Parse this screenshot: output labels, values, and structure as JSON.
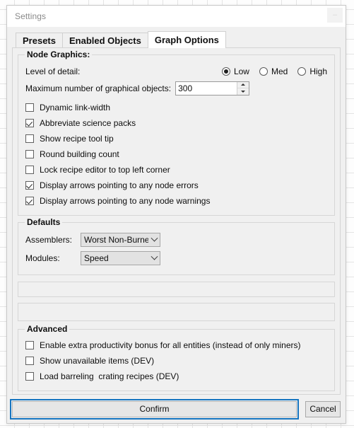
{
  "window": {
    "title": "Settings",
    "minimize_label": "–"
  },
  "tabs": [
    {
      "label": "Presets",
      "selected": false
    },
    {
      "label": "Enabled Objects",
      "selected": false
    },
    {
      "label": "Graph Options",
      "selected": true
    }
  ],
  "node_graphics": {
    "title": "Node Graphics:",
    "level_of_detail_label": "Level of detail:",
    "level_of_detail_options": [
      {
        "label": "Low",
        "selected": true
      },
      {
        "label": "Med",
        "selected": false
      },
      {
        "label": "High",
        "selected": false
      }
    ],
    "max_objects_label": "Maximum number of graphical objects:",
    "max_objects_value": "300",
    "checkboxes": [
      {
        "label": "Dynamic link-width",
        "checked": false
      },
      {
        "label": "Abbreviate science packs",
        "checked": true
      },
      {
        "label": "Show recipe tool tip",
        "checked": false
      },
      {
        "label": "Round building count",
        "checked": false
      },
      {
        "label": "Lock recipe editor to top left corner",
        "checked": false
      },
      {
        "label": "Display arrows pointing to any node errors",
        "checked": true
      },
      {
        "label": "Display arrows pointing to any node warnings",
        "checked": true
      }
    ]
  },
  "defaults": {
    "title": "Defaults",
    "assemblers_label": "Assemblers:",
    "assemblers_value": "Worst Non-Burner",
    "modules_label": "Modules:",
    "modules_value": "Speed"
  },
  "advanced": {
    "title": "Advanced",
    "checkboxes": [
      {
        "label": "Enable extra productivity bonus for all entities (instead of only miners)",
        "checked": false
      },
      {
        "label": "Show unavailable items (DEV)",
        "checked": false
      },
      {
        "label": "Load barreling  crating recipes (DEV)",
        "checked": false
      }
    ]
  },
  "footer": {
    "confirm_label": "Confirm",
    "cancel_label": "Cancel"
  },
  "colors": {
    "accent": "#1675c0",
    "dialog_bg": "#f0f0f0",
    "titlebar_bg": "#ffffff",
    "text": "#0d0d0d",
    "title_text": "#8a8a8a"
  }
}
